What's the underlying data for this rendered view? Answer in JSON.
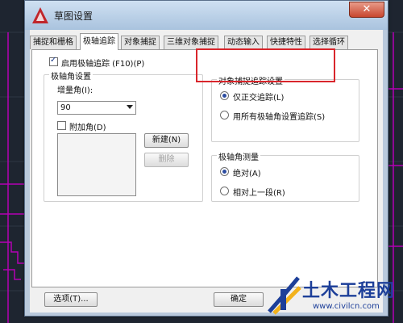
{
  "dialog": {
    "title": "草图设置",
    "close_label": "✕"
  },
  "tabs": [
    {
      "label": "捕捉和栅格"
    },
    {
      "label": "极轴追踪"
    },
    {
      "label": "对象捕捉"
    },
    {
      "label": "三维对象捕捉"
    },
    {
      "label": "动态输入"
    },
    {
      "label": "快捷特性"
    },
    {
      "label": "选择循环"
    }
  ],
  "active_tab": "极轴追踪",
  "polar": {
    "enable_label": "启用极轴追踪 (F10)(P)",
    "enable_checked": true,
    "angle_group_title": "极轴角设置",
    "increment_label": "增量角(I):",
    "increment_value": "90",
    "additional_label": "附加角(D)",
    "additional_checked": false,
    "new_button": "新建(N)",
    "delete_button": "删除"
  },
  "snap_tracking": {
    "group_title": "对象捕捉追踪设置",
    "option1": "仅正交追踪(L)",
    "option2": "用所有极轴角设置追踪(S)",
    "selected": "仅正交追踪(L)"
  },
  "measurement": {
    "group_title": "极轴角测量",
    "option1": "绝对(A)",
    "option2": "相对上一段(R)",
    "selected": "绝对(A)"
  },
  "footer": {
    "options_button": "选项(T)...",
    "ok_button": "确定"
  },
  "watermark": {
    "title": "土木工程网",
    "url": "www.civilcn.com"
  },
  "colors": {
    "highlight_box": "#d9262c",
    "cad_lines": "#b400b4"
  }
}
